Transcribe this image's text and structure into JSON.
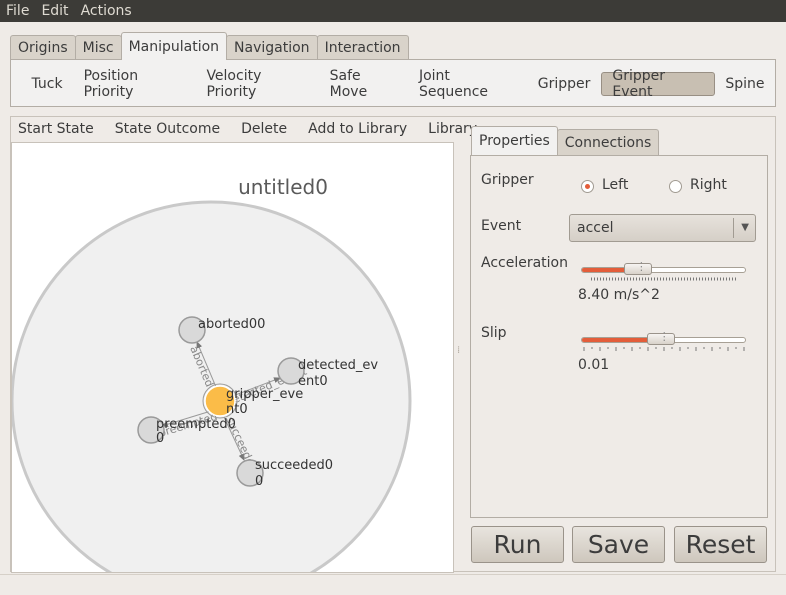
{
  "menubar": {
    "items": [
      "File",
      "Edit",
      "Actions"
    ]
  },
  "main_tabs": [
    "Origins",
    "Misc",
    "Manipulation",
    "Navigation",
    "Interaction"
  ],
  "active_main_tab": "Manipulation",
  "tools": [
    "Tuck",
    "Position Priority",
    "Velocity Priority",
    "Safe Move",
    "Joint Sequence",
    "Gripper",
    "Gripper Event",
    "Spine"
  ],
  "active_tool": "Gripper Event",
  "state_toolbar": [
    "Start State",
    "State Outcome",
    "Delete",
    "Add to Library",
    "Library"
  ],
  "graph": {
    "title": "untitled0",
    "center_node": {
      "label1": "gripper_eve",
      "label2": "nt0"
    },
    "nodes": [
      {
        "label1": "aborted00",
        "label2": ""
      },
      {
        "label1": "detected_ev",
        "label2": "ent0"
      },
      {
        "label1": "preempted0",
        "label2": "0"
      },
      {
        "label1": "succeeded0",
        "label2": "0"
      }
    ],
    "edge_labels": [
      "aborted",
      "detected_event",
      "preempted",
      "succeeded"
    ]
  },
  "right_tabs": [
    "Properties",
    "Connections"
  ],
  "active_right_tab": "Properties",
  "properties": {
    "gripper_label": "Gripper",
    "gripper_options": [
      "Left",
      "Right"
    ],
    "gripper_selected": "Left",
    "event_label": "Event",
    "event_value": "accel",
    "acceleration_label": "Acceleration",
    "acceleration_value": "8.40 m/s^2",
    "acceleration_fraction": 0.31,
    "slip_label": "Slip",
    "slip_value": "0.01",
    "slip_fraction": 0.48
  },
  "buttons": {
    "run": "Run",
    "save": "Save",
    "reset": "Reset"
  },
  "colors": {
    "accent": "#e35d3a",
    "center_node": "#fbbc48",
    "node": "#d9d9d9",
    "disc": "#f0f0f0"
  }
}
